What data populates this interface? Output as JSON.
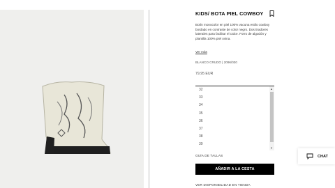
{
  "product": {
    "title": "KIDS/ BOTA PIEL COWBOY",
    "description": "Botín monocolor en piel 100% vacuna estilo cowboy bordado en contraste de color negro. Dos tiradores laterales para facilitar el calce. Forro de algodón y plantilla 100% piel ovina.",
    "more_link": "Ver más",
    "reference": "BLANCO CRUDO | 2096/030",
    "price": "79,95 EUR"
  },
  "sizes": [
    "32",
    "33",
    "34",
    "35",
    "36",
    "37",
    "38",
    "39"
  ],
  "size_guide": "GUÍA DE TALLAS",
  "add_to_cart": "AÑADIR A LA CESTA",
  "store_availability": "VER DISPONIBILIDAD EN TIENDA",
  "chat": {
    "label": "CHAT",
    "icon": "chat-bubble-icon"
  },
  "icons": {
    "bookmark": "bookmark-icon"
  }
}
